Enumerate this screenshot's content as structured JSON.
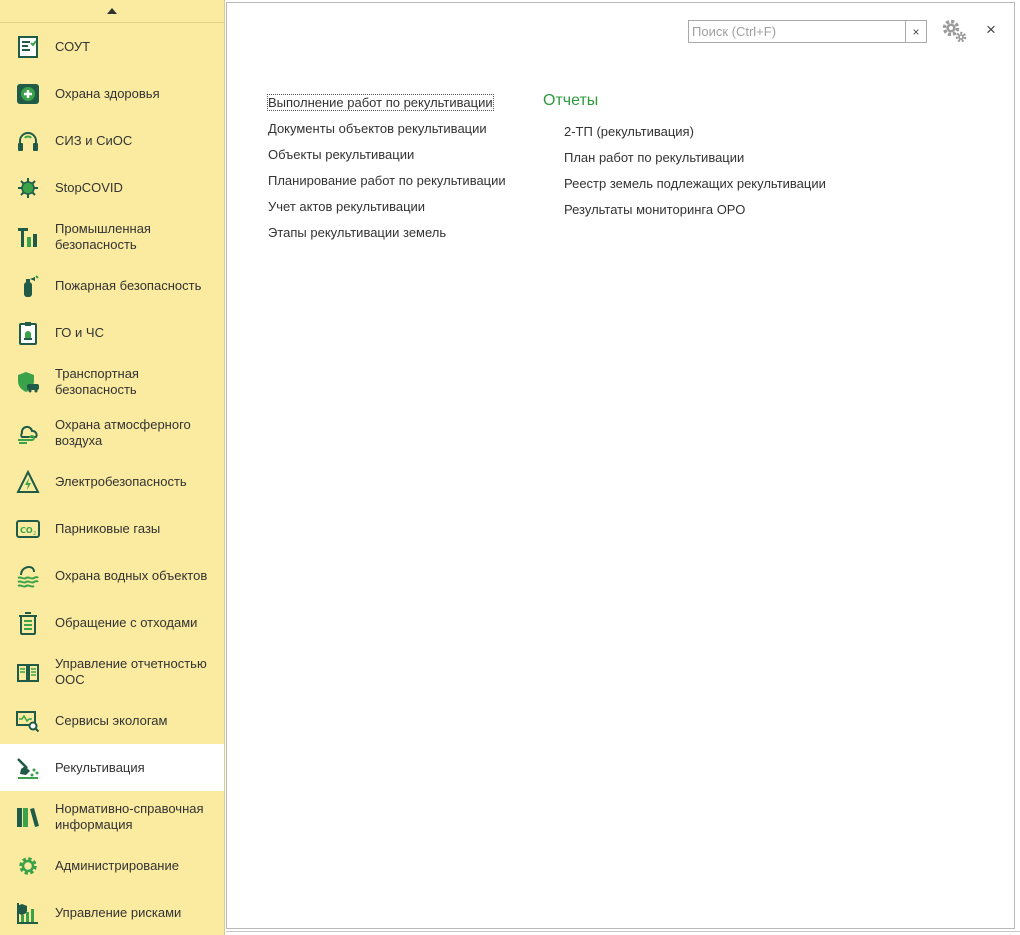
{
  "sidebar": {
    "items": [
      {
        "label": "СОУТ",
        "icon": "checklist-icon"
      },
      {
        "label": "Охрана здоровья",
        "icon": "medical-cross-icon"
      },
      {
        "label": "СИЗ и СиОС",
        "icon": "headphones-icon"
      },
      {
        "label": "StopCOVID",
        "icon": "virus-icon"
      },
      {
        "label": "Промышленная безопасность",
        "icon": "industry-icon"
      },
      {
        "label": "Пожарная безопасность",
        "icon": "fire-extinguisher-icon"
      },
      {
        "label": "ГО и ЧС",
        "icon": "clipboard-alarm-icon"
      },
      {
        "label": "Транспортная безопасность",
        "icon": "shield-car-icon"
      },
      {
        "label": "Охрана атмосферного воздуха",
        "icon": "cloud-wind-icon"
      },
      {
        "label": "Электробезопасность",
        "icon": "lightning-icon"
      },
      {
        "label": "Парниковые газы",
        "icon": "co2-icon"
      },
      {
        "label": "Охрана водных объектов",
        "icon": "water-waves-icon"
      },
      {
        "label": "Обращение с отходами",
        "icon": "recycle-bin-icon"
      },
      {
        "label": "Управление отчетностью ООС",
        "icon": "book-report-icon"
      },
      {
        "label": "Сервисы экологам",
        "icon": "monitor-search-icon"
      },
      {
        "label": "Рекультивация",
        "icon": "shovel-icon",
        "active": true
      },
      {
        "label": "Нормативно-справочная информация",
        "icon": "binders-icon"
      },
      {
        "label": "Администрирование",
        "icon": "gear-icon"
      },
      {
        "label": "Управление рисками",
        "icon": "risk-chart-icon"
      }
    ]
  },
  "search": {
    "placeholder": "Поиск (Ctrl+F)",
    "value": "",
    "clear_label": "×"
  },
  "window": {
    "close_label": "×"
  },
  "main": {
    "links": [
      "Выполнение работ по рекультивации",
      "Документы объектов рекультивации",
      "Объекты рекультивации",
      "Планирование работ по рекультивации",
      "Учет актов рекультивации",
      "Этапы рекультивации земель"
    ],
    "reports_title": "Отчеты",
    "reports": [
      "2-ТП (рекультивация)",
      "План работ по рекультивации",
      "Реестр земель подлежащих рекультивации",
      "Результаты мониторинга ОРО"
    ]
  },
  "colors": {
    "sidebar_bg": "#faeba0",
    "accent_green": "#2e9a3e",
    "icon_dark": "#1f5b46"
  }
}
